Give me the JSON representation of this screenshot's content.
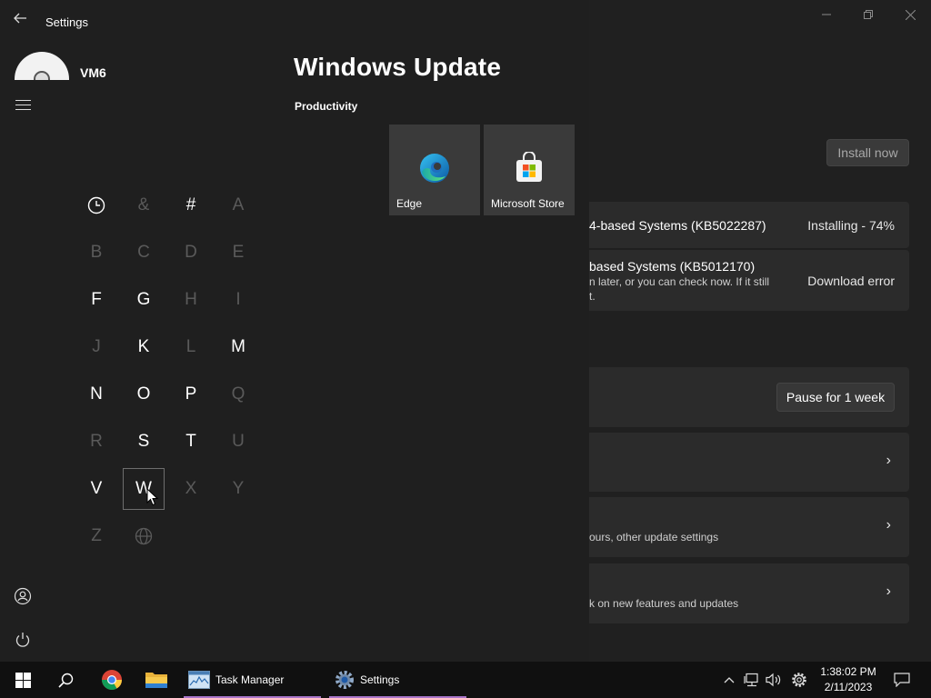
{
  "settings_window": {
    "page_title": "Windows Update",
    "install_now_label": "Install now",
    "updates": [
      {
        "name": "4-based Systems (KB5022287)",
        "status": "Installing - 74%"
      },
      {
        "name": "based Systems (KB5012170)",
        "sub_line1": "n later, or you can check now. If it still",
        "sub_line2": "t.",
        "status": "Download error"
      }
    ],
    "pause_label": "Pause for 1 week",
    "option_descriptions": [
      "ours, other update settings",
      "k on new features and updates"
    ]
  },
  "start_menu": {
    "app_title": "Settings",
    "user_name": "VM6",
    "group_label": "Productivity",
    "tiles": [
      {
        "label": "Edge"
      },
      {
        "label": "Microsoft Store"
      }
    ],
    "alphabet": [
      {
        "label": "",
        "icon": "clock-icon",
        "enabled": true
      },
      {
        "label": "&",
        "enabled": false
      },
      {
        "label": "#",
        "enabled": true
      },
      {
        "label": "A",
        "enabled": false
      },
      {
        "label": "B",
        "enabled": false
      },
      {
        "label": "C",
        "enabled": false
      },
      {
        "label": "D",
        "enabled": false
      },
      {
        "label": "E",
        "enabled": false
      },
      {
        "label": "F",
        "enabled": true
      },
      {
        "label": "G",
        "enabled": true
      },
      {
        "label": "H",
        "enabled": false
      },
      {
        "label": "I",
        "enabled": false
      },
      {
        "label": "J",
        "enabled": false
      },
      {
        "label": "K",
        "enabled": true
      },
      {
        "label": "L",
        "enabled": false
      },
      {
        "label": "M",
        "enabled": true
      },
      {
        "label": "N",
        "enabled": true
      },
      {
        "label": "O",
        "enabled": true
      },
      {
        "label": "P",
        "enabled": true
      },
      {
        "label": "Q",
        "enabled": false
      },
      {
        "label": "R",
        "enabled": false
      },
      {
        "label": "S",
        "enabled": true
      },
      {
        "label": "T",
        "enabled": true
      },
      {
        "label": "U",
        "enabled": false
      },
      {
        "label": "V",
        "enabled": true
      },
      {
        "label": "W",
        "enabled": true,
        "selected": true
      },
      {
        "label": "X",
        "enabled": false
      },
      {
        "label": "Y",
        "enabled": false
      },
      {
        "label": "Z",
        "enabled": false
      },
      {
        "label": "",
        "icon": "globe-icon",
        "enabled": false
      }
    ]
  },
  "taskbar": {
    "apps": [
      {
        "label": "Task Manager"
      },
      {
        "label": "Settings"
      }
    ],
    "clock": {
      "time": "1:38:02 PM",
      "date": "2/11/2023"
    },
    "accent_color": "#a874c9"
  }
}
